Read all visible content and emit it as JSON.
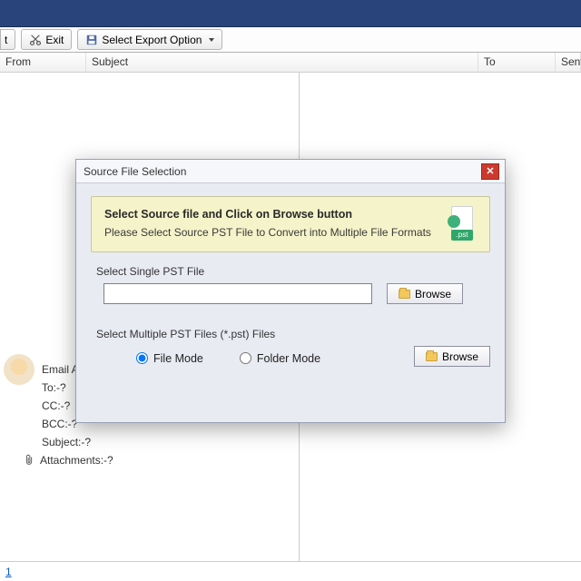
{
  "toolbar": {
    "btn1_suffix": "t",
    "exit_label": "Exit",
    "export_label": "Select Export Option"
  },
  "columns": {
    "from": "From",
    "subject": "Subject",
    "to": "To",
    "sent": "Sent"
  },
  "details": {
    "email_label": "Email A",
    "to": "To:-?",
    "cc": "CC:-?",
    "bcc": "BCC:-?",
    "subject": "Subject:-?",
    "attachments": "Attachments:-?"
  },
  "footer": {
    "link": "1"
  },
  "modal": {
    "title": "Source File Selection",
    "banner_title": "Select Source file and Click on Browse button",
    "banner_sub": "Please Select Source PST File to Convert into Multiple File Formats",
    "pst_tag": ".pst",
    "single_label": "Select Single PST File",
    "single_value": "",
    "browse_label": "Browse",
    "multiple_label": "Select Multiple PST Files (*.pst) Files",
    "file_mode_label": "File Mode",
    "folder_mode_label": "Folder Mode"
  }
}
